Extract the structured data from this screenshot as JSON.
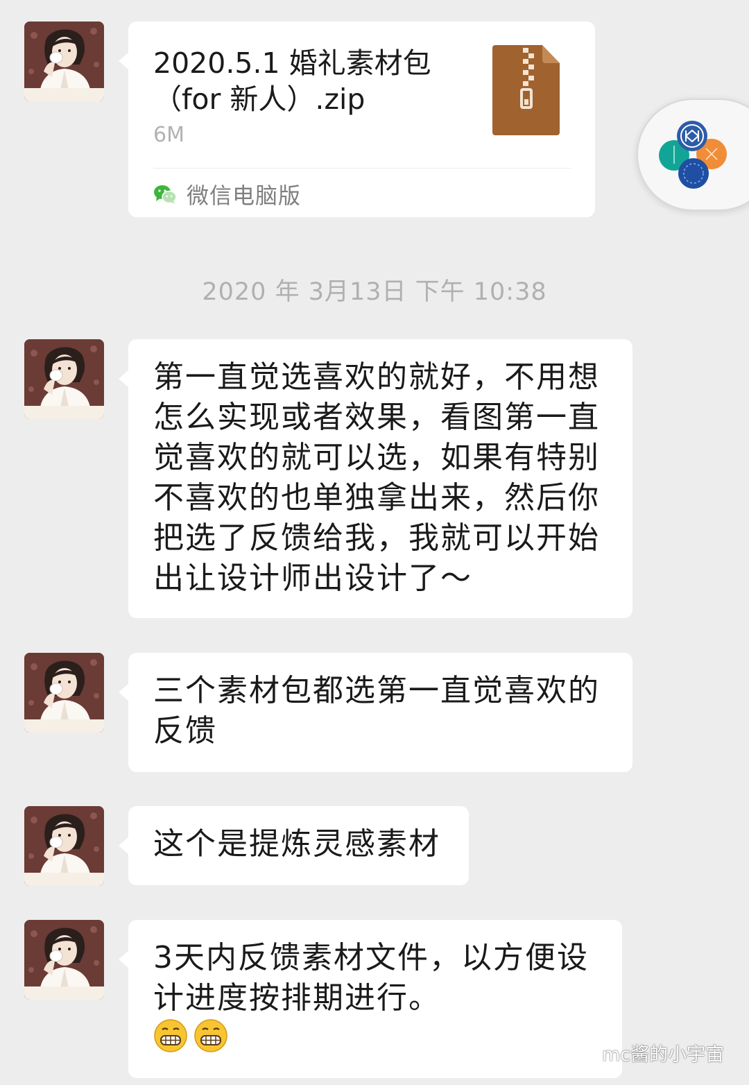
{
  "file_message": {
    "file_name": "2020.5.1 婚礼素材包\n（for 新人）.zip",
    "file_size": "6M",
    "file_icon": "zip-archive-icon",
    "source_label": "微信电脑版",
    "source_icon": "wechat-icon"
  },
  "timestamp": "2020 年 3月13日  下午 10:38",
  "messages": [
    {
      "text": "第一直觉选喜欢的就好，不用想\n怎么实现或者效果，看图第一直\n觉喜欢的就可以选，如果有特别\n不喜欢的也单独拿出来，然后你\n把选了反馈给我，我就可以开始\n出让设计师出设计了～"
    },
    {
      "text": "三个素材包都选第一直觉喜欢的\n反馈"
    },
    {
      "text": "这个是提炼灵感素材"
    },
    {
      "text": "3天内反馈素材文件，以方便设\n计进度按排期进行。",
      "emojis": [
        "grimacing-emoji",
        "grimacing-emoji"
      ]
    }
  ],
  "watermark": {
    "text": "mc酱的小宇宙",
    "icon": "wechat-official-account-icon"
  },
  "floating_widget": {
    "icon": "floating-window-icon"
  },
  "colors": {
    "background": "#ededed",
    "bubble": "#ffffff",
    "timestamp": "#b0b0b0",
    "file_icon": "#a0622e",
    "wechat_green": "#3db53d"
  }
}
